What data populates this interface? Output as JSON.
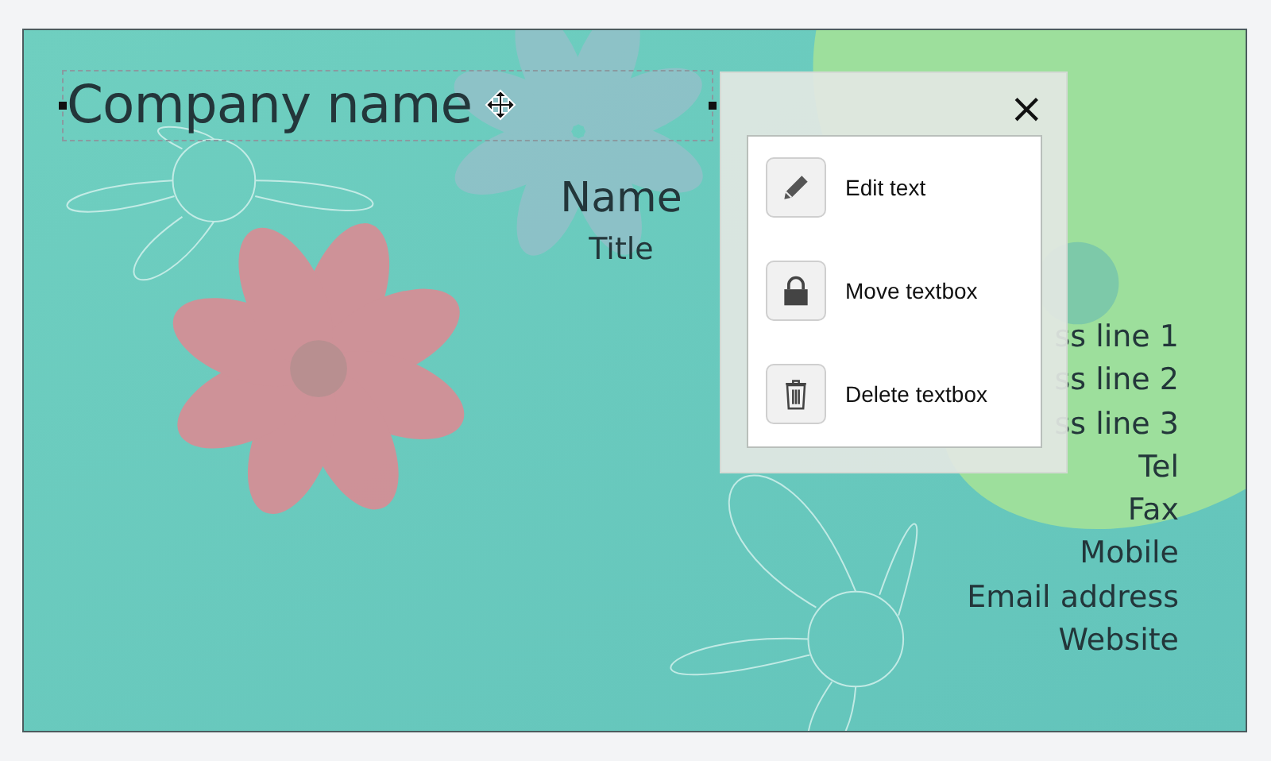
{
  "card": {
    "company": {
      "text": "Company name",
      "selected": true
    },
    "name": "Name",
    "title": "Title",
    "details": [
      "ss line 1",
      "ss line 2",
      "ss line 3",
      "Tel",
      "Fax",
      "Mobile",
      "Email address",
      "Website"
    ]
  },
  "popup": {
    "close": "×",
    "items": [
      {
        "kind": "edit",
        "label": "Edit text"
      },
      {
        "kind": "lock",
        "label": "Move textbox"
      },
      {
        "kind": "delete",
        "label": "Delete textbox"
      }
    ]
  }
}
